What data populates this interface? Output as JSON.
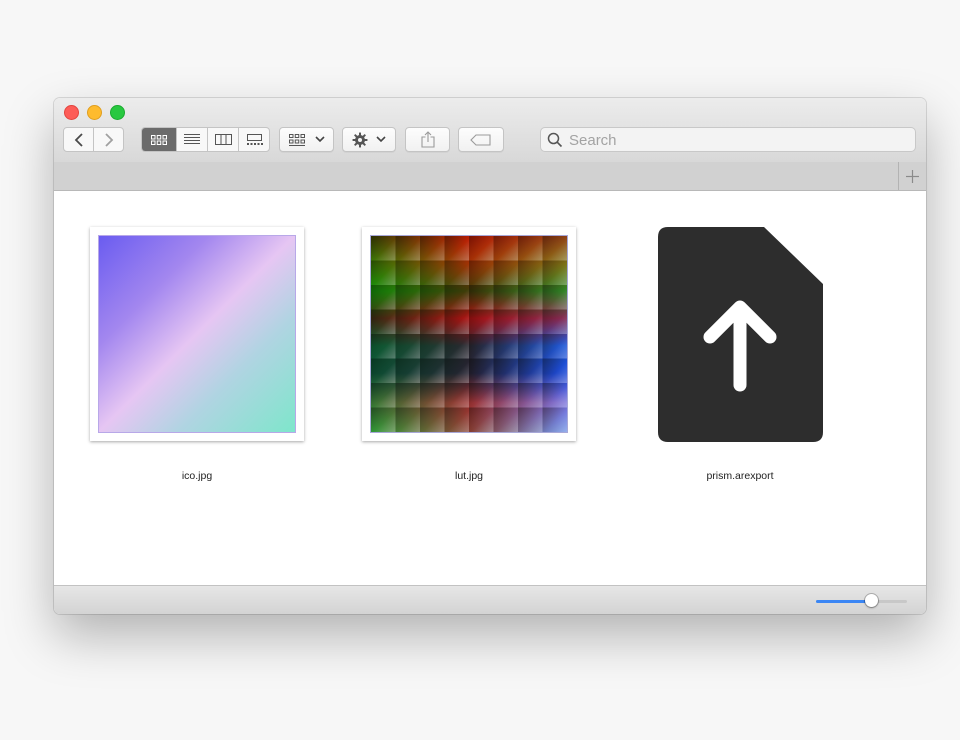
{
  "window": {
    "traffic_lights": [
      {
        "name": "close",
        "color": "#fd5c57"
      },
      {
        "name": "minimize",
        "color": "#febb2e"
      },
      {
        "name": "zoom",
        "color": "#28c840"
      }
    ]
  },
  "toolbar": {
    "back_icon": "chevron-left-icon",
    "forward_icon": "chevron-right-icon",
    "view_modes": [
      "icon-view",
      "list-view",
      "column-view",
      "gallery-view"
    ],
    "active_view": "icon-view",
    "group_icon": "group-by-icon",
    "action_icon": "gear-icon",
    "share_icon": "share-icon",
    "tag_icon": "tag-icon"
  },
  "search": {
    "placeholder": "Search",
    "value": ""
  },
  "files": [
    {
      "name": "ico.jpg",
      "kind": "image-gradient"
    },
    {
      "name": "lut.jpg",
      "kind": "image-lut"
    },
    {
      "name": "prism.arexport",
      "kind": "document-upload-icon"
    }
  ],
  "statusbar": {
    "icon_size_fraction": 0.61,
    "accent": "#3b86f4"
  }
}
